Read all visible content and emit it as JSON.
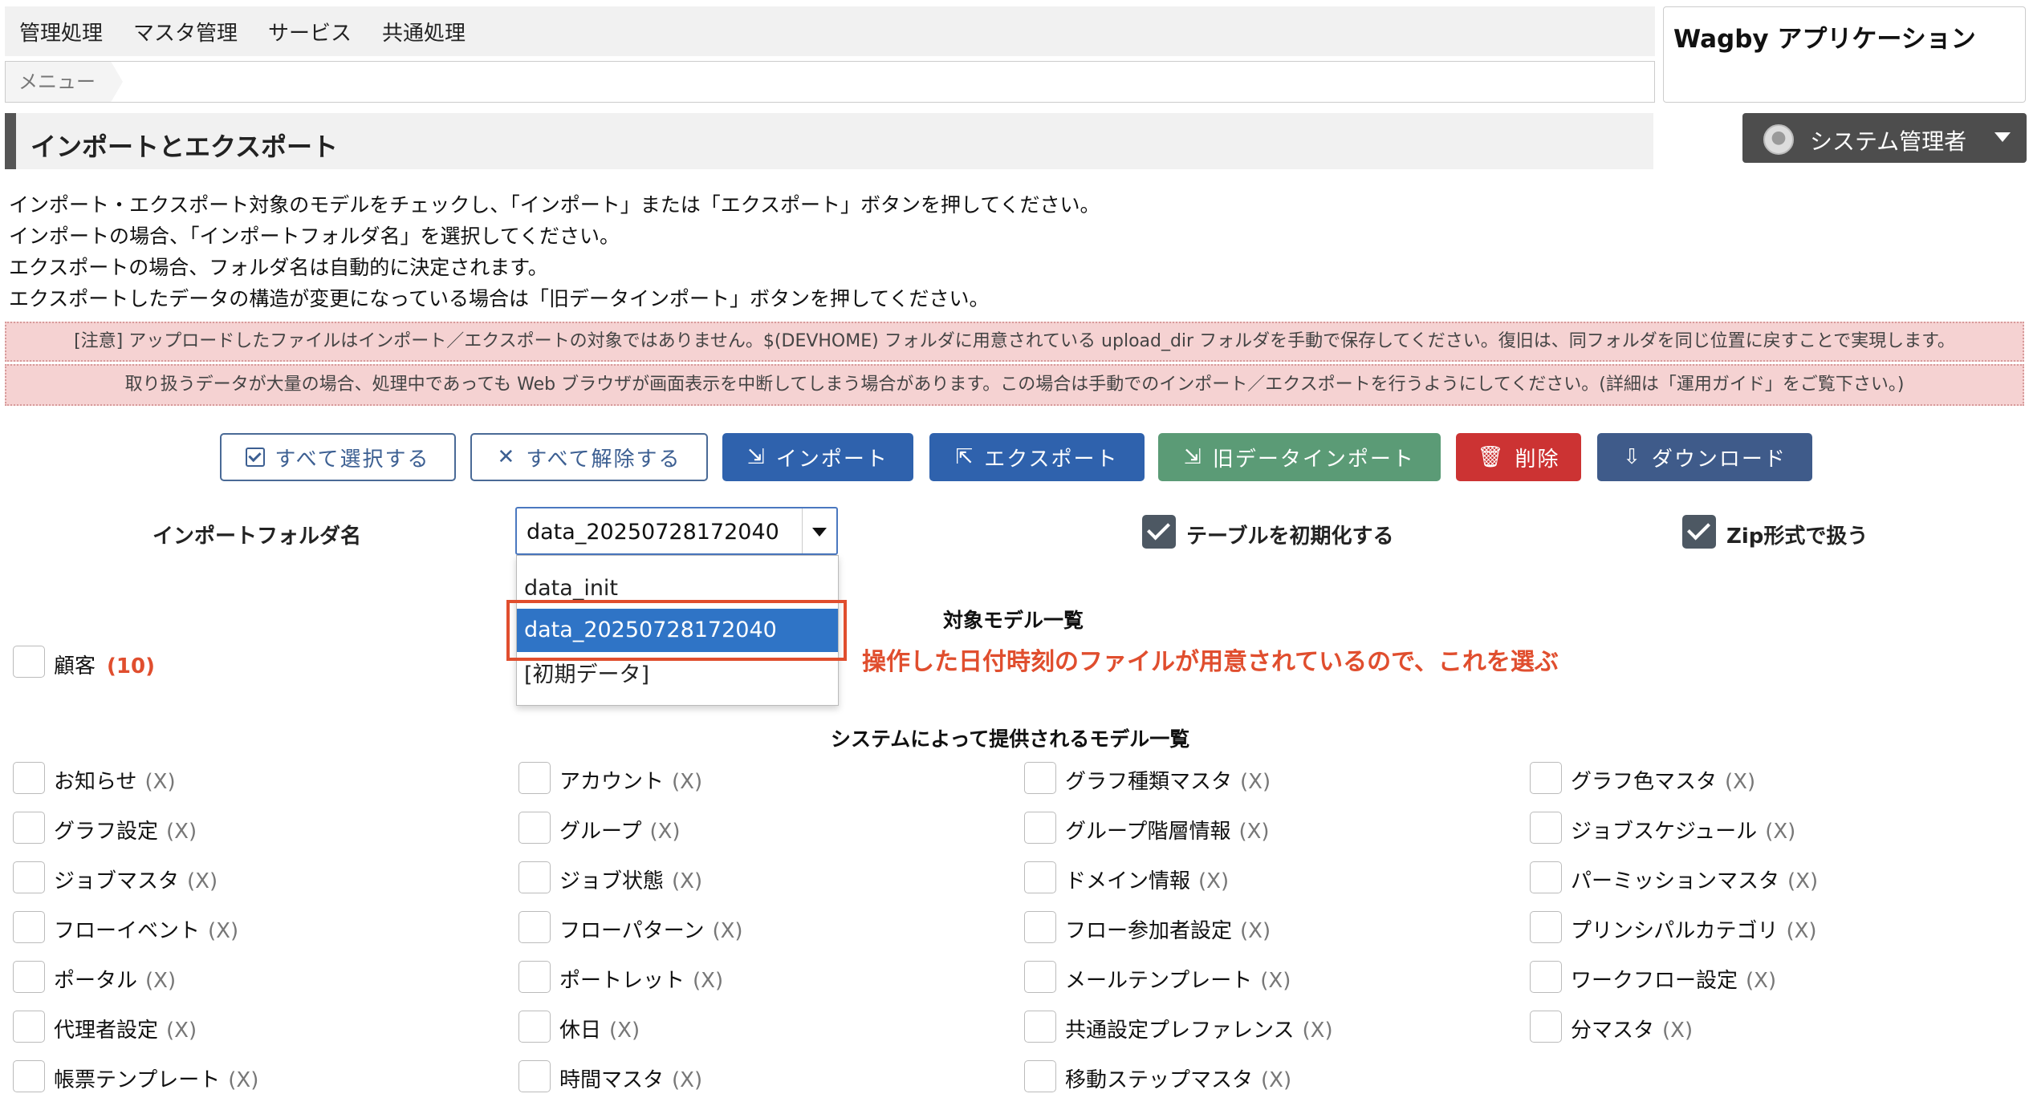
{
  "top_menu": [
    "管理処理",
    "マスタ管理",
    "サービス",
    "共通処理"
  ],
  "breadcrumb": "メニュー",
  "app_title": "Wagby アプリケーション",
  "page_title": "インポートとエクスポート",
  "user": {
    "name": "システム管理者",
    "icon": "user-avatar-icon"
  },
  "instructions": [
    "インポート・エクスポート対象のモデルをチェックし、「インポート」または「エクスポート」ボタンを押してください。",
    "インポートの場合、「インポートフォルダ名」を選択してください。",
    "エクスポートの場合、フォルダ名は自動的に決定されます。",
    "エクスポートしたデータの構造が変更になっている場合は「旧データインポート」ボタンを押してください。"
  ],
  "notices": [
    "[注意] アップロードしたファイルはインポート／エクスポートの対象ではありません。$(DEVHOME) フォルダに用意されている upload_dir フォルダを手動で保存してください。復旧は、同フォルダを同じ位置に戻すことで実現します。",
    "取り扱うデータが大量の場合、処理中であっても Web ブラウザが画面表示を中断してしまう場合があります。この場合は手動でのインポート／エクスポートを行うようにしてください。(詳細は「運用ガイド」をご覧下さい。)"
  ],
  "buttons": {
    "select_all": "すべて選択する",
    "deselect_all": "すべて解除する",
    "import": "インポート",
    "export": "エクスポート",
    "old_import": "旧データインポート",
    "delete": "削除",
    "download": "ダウンロード"
  },
  "colors": {
    "primary": "#2f62ad",
    "success": "#5b9b76",
    "danger": "#cc3333",
    "navy": "#3f5b8a",
    "annotation": "#e04e2e",
    "notice_bg": "#f5d2d2"
  },
  "import_folder": {
    "label": "インポートフォルダ名",
    "selected": "data_20250728172040",
    "options": [
      "data_init",
      "data_20250728172040",
      "[初期データ]"
    ]
  },
  "options": {
    "init_table": "テーブルを初期化する",
    "init_table_checked": true,
    "zip": "Zip形式で扱う",
    "zip_checked": true
  },
  "annotation": "操作した日付時刻のファイルが用意されているので、これを選ぶ",
  "target_models": {
    "title": "対象モデル一覧",
    "items": [
      {
        "label": "顧客",
        "count": "(10)"
      }
    ]
  },
  "system_models": {
    "title": "システムによって提供されるモデル一覧",
    "count_label": "(X)",
    "columns": [
      [
        "お知らせ",
        "グラフ設定",
        "ジョブマスタ",
        "フローイベント",
        "ポータル",
        "代理者設定",
        "帳票テンプレート"
      ],
      [
        "アカウント",
        "グループ",
        "ジョブ状態",
        "フローパターン",
        "ポートレット",
        "休日",
        "時間マスタ"
      ],
      [
        "グラフ種類マスタ",
        "グループ階層情報",
        "ドメイン情報",
        "フロー参加者設定",
        "メールテンプレート",
        "共通設定プレファレンス",
        "移動ステップマスタ"
      ],
      [
        "グラフ色マスタ",
        "ジョブスケジュール",
        "パーミッションマスタ",
        "プリンシパルカテゴリ",
        "ワークフロー設定",
        "分マスタ"
      ]
    ]
  }
}
